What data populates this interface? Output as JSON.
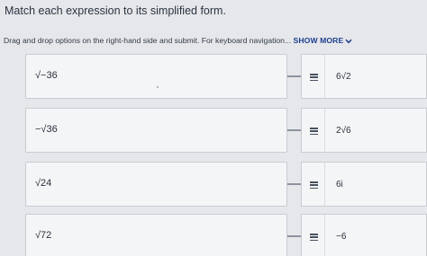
{
  "header": {
    "title": "Match each expression to its simplified form.",
    "instructions": "Drag and drop options on the right-hand side and submit. For keyboard navigation...",
    "show_more": "SHOW MORE"
  },
  "rows": [
    {
      "expression": "√−36",
      "option": "6√2"
    },
    {
      "expression": "−√36",
      "option": "2√6"
    },
    {
      "expression": "√24",
      "option": "6i"
    },
    {
      "expression": "√72",
      "option": "−6"
    }
  ],
  "icons": {
    "drag_handle": "drag-handle-icon",
    "chevron": "chevron-down-icon"
  },
  "colors": {
    "accent": "#1d3f8f",
    "background": "#e6e7ea",
    "card": "#f4f5f7"
  }
}
